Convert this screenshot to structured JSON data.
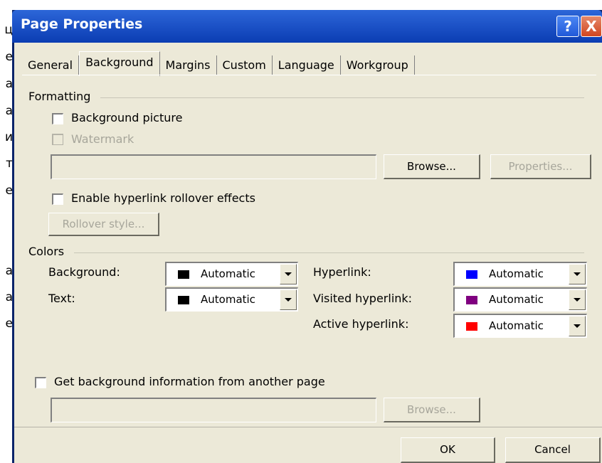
{
  "side_letters": [
    "ц",
    "е",
    "а",
    "а",
    "и",
    "т",
    "е",
    "а",
    "а",
    "е"
  ],
  "dialog": {
    "title": "Page Properties",
    "help_glyph": "?",
    "close_glyph": "X"
  },
  "tabs": [
    {
      "label": "General",
      "active": false
    },
    {
      "label": "Background",
      "active": true
    },
    {
      "label": "Margins",
      "active": false
    },
    {
      "label": "Custom",
      "active": false
    },
    {
      "label": "Language",
      "active": false
    },
    {
      "label": "Workgroup",
      "active": false
    }
  ],
  "formatting": {
    "group_label": "Formatting",
    "background_picture": {
      "label": "Background picture",
      "checked": false
    },
    "watermark": {
      "label": "Watermark",
      "checked": false,
      "disabled": true
    },
    "picture_path": {
      "value": ""
    },
    "browse_label": "Browse...",
    "properties_label": "Properties...",
    "rollover": {
      "label": "Enable hyperlink rollover effects",
      "checked": false
    },
    "rollover_style_label": "Rollover style..."
  },
  "colors": {
    "group_label": "Colors",
    "background": {
      "label": "Background:",
      "value": "Automatic",
      "swatch": "#000000"
    },
    "text": {
      "label": "Text:",
      "value": "Automatic",
      "swatch": "#000000"
    },
    "hyperlink": {
      "label": "Hyperlink:",
      "value": "Automatic",
      "swatch": "#0000ff"
    },
    "visited_hyperlink": {
      "label": "Visited hyperlink:",
      "value": "Automatic",
      "swatch": "#800080"
    },
    "active_hyperlink": {
      "label": "Active hyperlink:",
      "value": "Automatic",
      "swatch": "#ff0000"
    }
  },
  "background_info": {
    "label": "Get background information from another page",
    "checked": false,
    "path": {
      "value": ""
    },
    "browse_label": "Browse..."
  },
  "footer": {
    "ok_label": "OK",
    "cancel_label": "Cancel"
  }
}
